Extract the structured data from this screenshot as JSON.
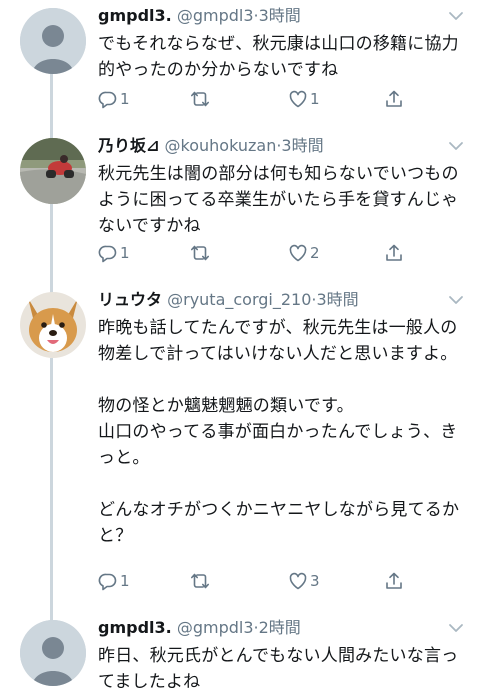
{
  "tweets": [
    {
      "name": "gmpdl3.",
      "handle": "@gmpdl3",
      "dot": "·",
      "time": "3時間",
      "text": "でもそれならなぜ、秋元康は山口の移籍に協力的やったのか分からないですね",
      "reply_count": "1",
      "retweet_count": "",
      "like_count": "1"
    },
    {
      "name": "乃り坂⊿",
      "handle": "@kouhokuzan",
      "dot": "·",
      "time": "3時間",
      "text": "秋元先生は闇の部分は何も知らないでいつものように困ってる卒業生がいたら手を貸すんじゃないですかね",
      "reply_count": "1",
      "retweet_count": "",
      "like_count": "2"
    },
    {
      "name": "リュウタ",
      "handle": "@ryuta_corgi_210",
      "dot": "·",
      "time": "3時間",
      "text": "昨晩も話してたんですが、秋元先生は一般人の物差しで計ってはいけない人だと思いますよ。\n\n物の怪とか魑魅魍魎の類いです。\n山口のやってる事が面白かったんでしょう、きっと。\n\nどんなオチがつくかニヤニヤしながら見てるかと？",
      "reply_count": "1",
      "retweet_count": "",
      "like_count": "3"
    },
    {
      "name": "gmpdl3.",
      "handle": "@gmpdl3",
      "dot": "·",
      "time": "2時間",
      "text": "昨日、秋元氏がとんでもない人間みたいな言ってましたよね",
      "reply_count": "",
      "retweet_count": "",
      "like_count": ""
    }
  ],
  "icons": {
    "reply": "reply-icon",
    "retweet": "retweet-icon",
    "like": "like-icon",
    "share": "share-icon",
    "caret": "chevron-down-icon"
  },
  "colors": {
    "text": "#14171a",
    "secondary": "#657786",
    "thread_line": "#ccd6dd",
    "avatar_default_bg": "#ccd6dd"
  }
}
